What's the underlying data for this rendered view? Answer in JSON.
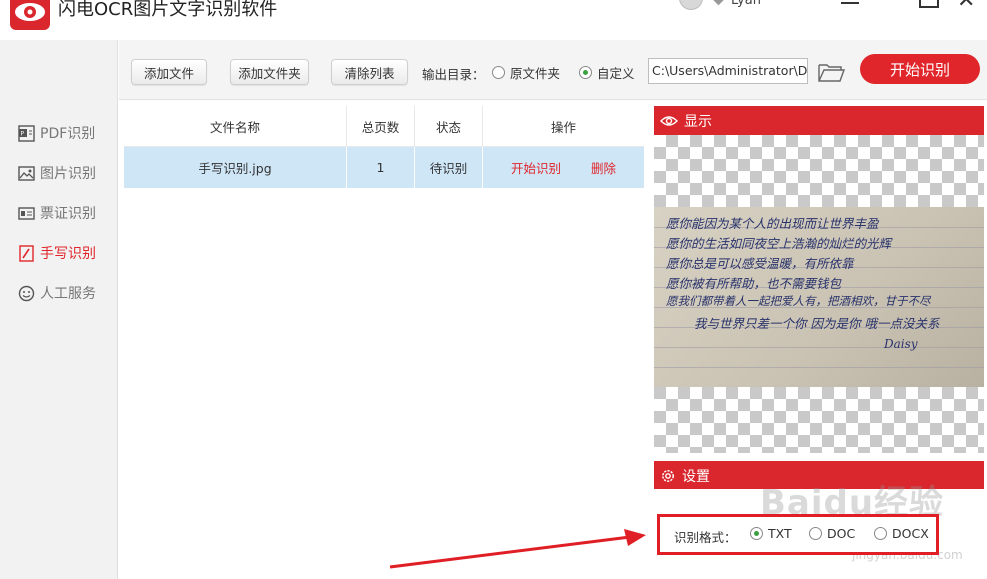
{
  "window": {
    "title": "闪电OCR图片文字识别软件",
    "user_name": "Lyan"
  },
  "sidebar": {
    "items": [
      {
        "label": "PDF识别",
        "icon": "pdf-icon",
        "active": false
      },
      {
        "label": "图片识别",
        "icon": "image-icon",
        "active": false
      },
      {
        "label": "票证识别",
        "icon": "id-card-icon",
        "active": false
      },
      {
        "label": "手写识别",
        "icon": "handwriting-icon",
        "active": true
      },
      {
        "label": "人工服务",
        "icon": "smiley-icon",
        "active": false
      }
    ]
  },
  "toolbar": {
    "add_file": "添加文件",
    "add_folder": "添加文件夹",
    "clear_list": "清除列表",
    "output_dir_label": "输出目录：",
    "option_source_folder": "原文件夹",
    "option_custom": "自定义",
    "selected_option": "自定义",
    "output_path": "C:\\Users\\Administrator\\De",
    "start_button": "开始识别"
  },
  "file_table": {
    "columns": [
      "文件名称",
      "总页数",
      "状态",
      "操作"
    ],
    "rows": [
      {
        "name": "手写识别.jpg",
        "pages": "1",
        "status": "待识别",
        "action_start": "开始识别",
        "action_delete": "删除"
      }
    ]
  },
  "display_panel": {
    "title": "显示",
    "handwriting_lines": [
      "愿你能因为某个人的出现而让世界丰盈",
      "愿你的生活如同夜空上浩瀚的灿烂的光辉",
      "愿你总是可以感受温暖，有所依靠",
      "愿你被有所帮助，也不需要钱包",
      "愿我们都带着人一起把爱人有，把酒相欢，甘于不尽",
      "我与世界只差一个你 因为是你 哦一点没关系"
    ],
    "signature": "Daisy"
  },
  "settings_panel": {
    "title": "设置",
    "format_label": "识别格式：",
    "formats": [
      "TXT",
      "DOC",
      "DOCX"
    ],
    "selected_format": "TXT"
  },
  "watermark": {
    "text": "Baidu经验",
    "subtext": "jingyan.baidu.com"
  },
  "colors": {
    "accent": "#e0262b",
    "selected_row": "#cfe6f7",
    "panel_header": "#d9272d",
    "highlight_box": "#e01e25"
  }
}
